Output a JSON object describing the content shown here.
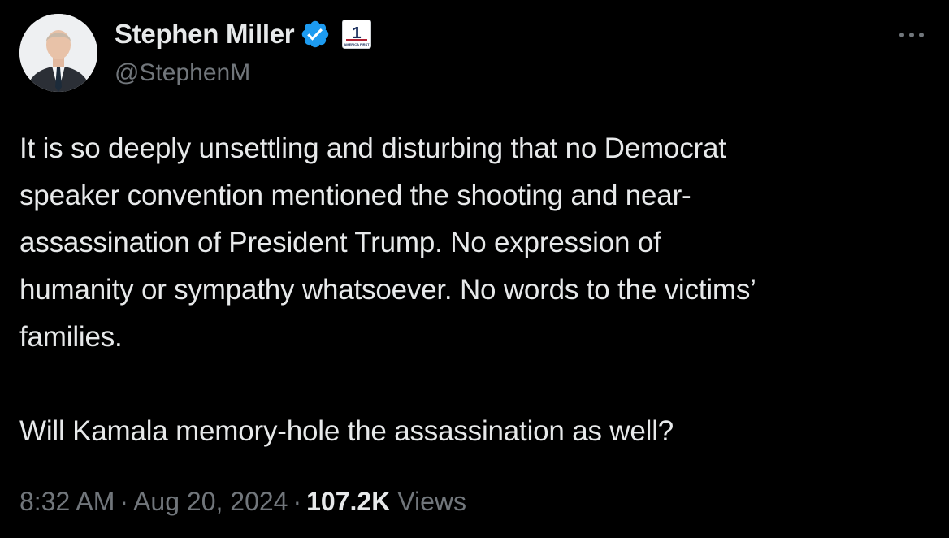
{
  "author": {
    "name": "Stephen Miller",
    "handle": "@StephenM",
    "verified": true,
    "affiliate_badge_text": "AMERICA FIRST"
  },
  "tweet": {
    "lines": [
      "It is so deeply unsettling and disturbing that no Democrat",
      "speaker convention mentioned the shooting and near-",
      "assassination of President Trump. No expression of",
      "humanity or sympathy whatsoever. No words to the victims’",
      "families."
    ],
    "lines2": [
      "Will Kamala memory-hole the assassination as well?"
    ]
  },
  "meta": {
    "time": "8:32 AM",
    "separator": "·",
    "date": "Aug 20, 2024",
    "views_count": "107.2K",
    "views_label": "Views"
  },
  "icons": {
    "verified": "verified-badge-icon",
    "more": "more-options-icon",
    "affiliate": "affiliate-badge-icon"
  },
  "colors": {
    "background": "#000000",
    "primary_text": "#e7e9ea",
    "secondary_text": "#71767b",
    "verified_blue": "#1d9bf0"
  }
}
